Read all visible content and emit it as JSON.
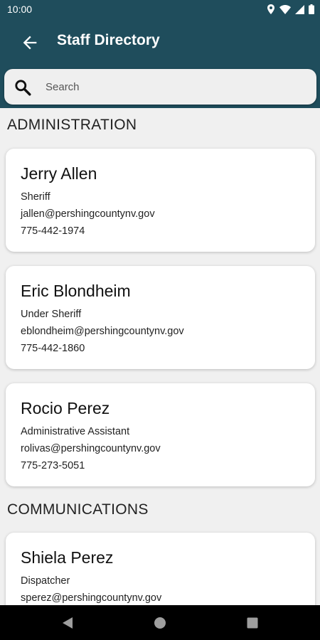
{
  "status_bar": {
    "time": "10:00"
  },
  "app_bar": {
    "title": "Staff Directory"
  },
  "search": {
    "placeholder": "Search"
  },
  "sections": [
    {
      "title": "ADMINISTRATION",
      "staff": [
        {
          "name": "Jerry Allen",
          "role": "Sheriff",
          "email": "jallen@pershingcountynv.gov",
          "phone": "775-442-1974"
        },
        {
          "name": "Eric Blondheim",
          "role": "Under Sheriff",
          "email": "eblondheim@pershingcountynv.gov",
          "phone": "775-442-1860"
        },
        {
          "name": "Rocio Perez",
          "role": "Administrative Assistant",
          "email": "rolivas@pershingcountynv.gov",
          "phone": "775-273-5051"
        }
      ]
    },
    {
      "title": "COMMUNICATIONS",
      "staff": [
        {
          "name": "Shiela Perez",
          "role": "Dispatcher",
          "email": "sperez@pershingcountynv.gov",
          "phone": ""
        }
      ]
    }
  ],
  "colors": {
    "app_bar": "#1f4d5c",
    "background": "#f0f0f0",
    "nav_bar": "#000000"
  },
  "icons": {
    "back": "arrow-left-icon",
    "search": "search-icon",
    "nav_back": "triangle-back-icon",
    "nav_home": "circle-home-icon",
    "nav_recents": "square-recents-icon"
  }
}
